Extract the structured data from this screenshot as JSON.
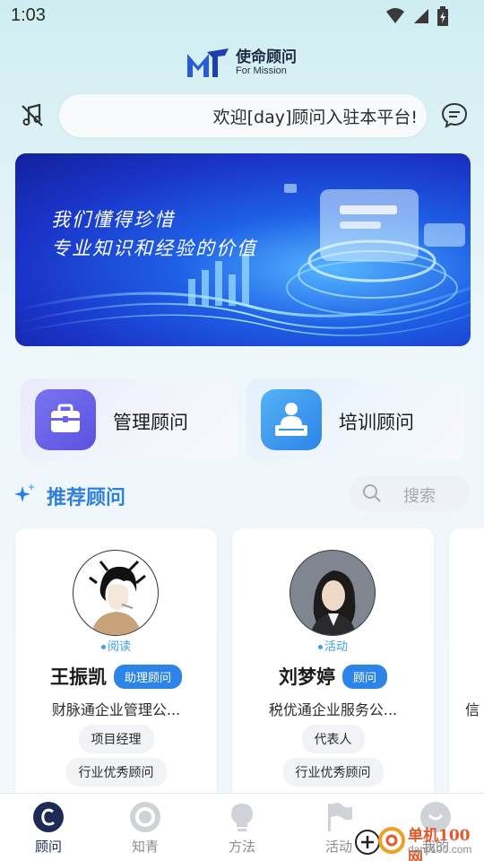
{
  "status_bar": {
    "time": "1:03",
    "icons": [
      "wifi-icon",
      "signal-icon",
      "battery-icon"
    ]
  },
  "logo": {
    "cn": "使命顾问",
    "en": "For Mission",
    "mark_color": "#2a5bd7"
  },
  "header": {
    "music_icon": "music-off-icon",
    "notice": "欢迎[day]顾问入驻本平台!",
    "message_icon": "message-icon"
  },
  "banner": {
    "line1": "我们懂得珍惜",
    "line2": "专业知识和经验的价值"
  },
  "categories": [
    {
      "label": "管理顾问",
      "icon": "briefcase-icon",
      "color": "#6c63ea"
    },
    {
      "label": "培训顾问",
      "icon": "trainer-icon",
      "color": "#3a9ae8"
    }
  ],
  "section": {
    "title": "推荐顾问",
    "icon": "sparkle-icon",
    "search_label": "搜索"
  },
  "consultants": [
    {
      "status": "阅读",
      "name": "王振凯",
      "role": "助理顾问",
      "company": "财脉通企业管理公...",
      "tags": [
        "项目经理",
        "行业优秀顾问"
      ]
    },
    {
      "status": "活动",
      "name": "刘梦婷",
      "role": "顾问",
      "company": "税优通企业服务公...",
      "tags": [
        "代表人",
        "行业优秀顾问"
      ]
    },
    {
      "company": "信"
    }
  ],
  "nav": [
    {
      "label": "顾问",
      "icon": "consultant-icon",
      "active": true
    },
    {
      "label": "知青",
      "icon": "knowledge-icon",
      "active": false
    },
    {
      "label": "方法",
      "icon": "bulb-icon",
      "active": false
    },
    {
      "label": "活动",
      "icon": "flag-icon",
      "active": false
    },
    {
      "label": "我的",
      "icon": "profile-icon",
      "active": false
    }
  ],
  "watermark": {
    "cn": "单机100网",
    "en": "danji100.com"
  },
  "colors": {
    "accent": "#2d84e8",
    "title_blue": "#2f7fe0",
    "nav_active": "#1e2b57"
  }
}
